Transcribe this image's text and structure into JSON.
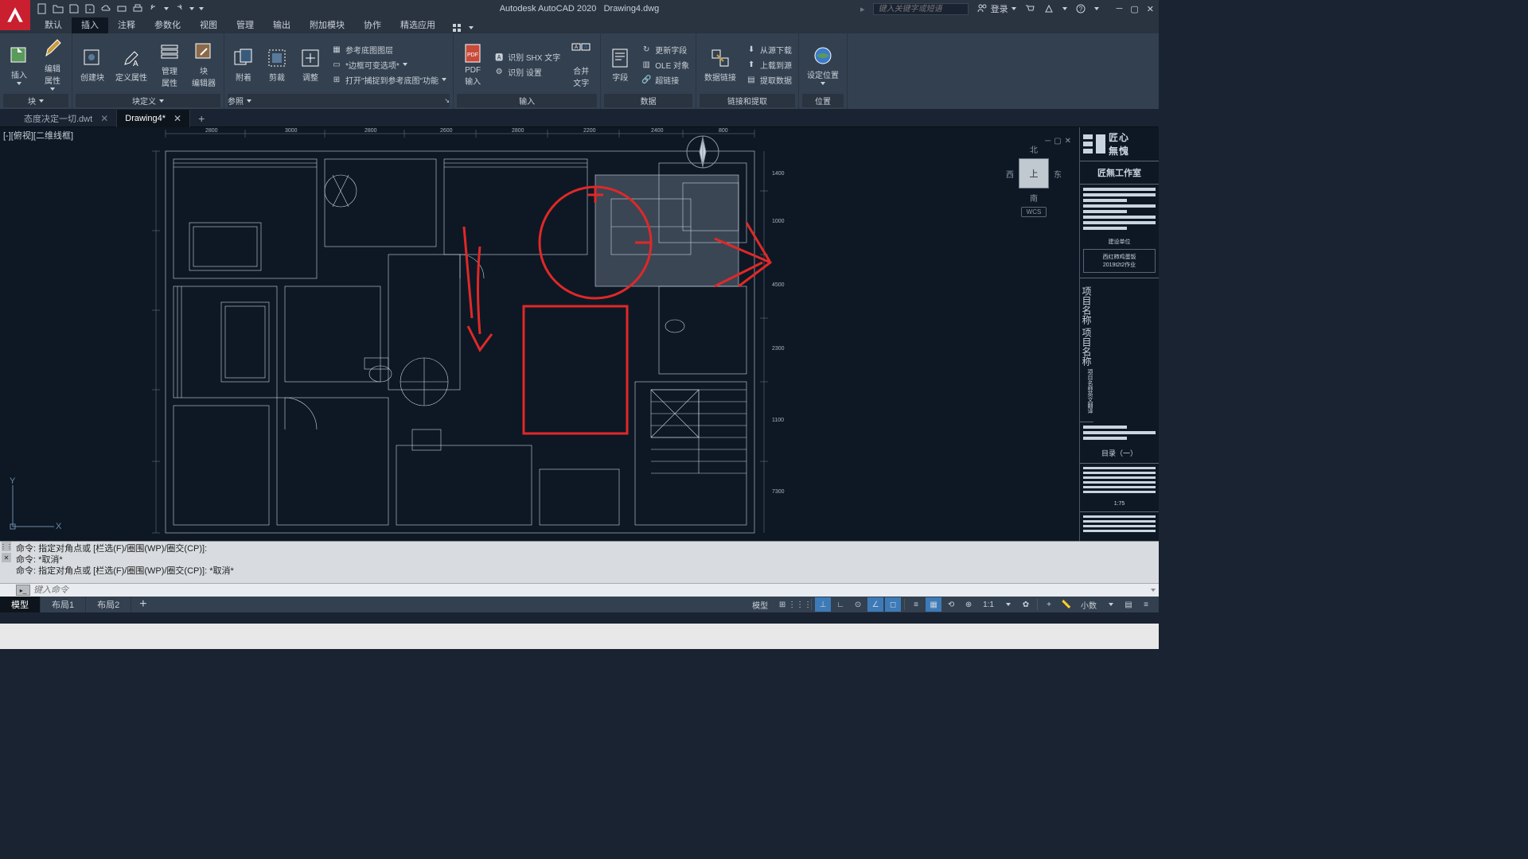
{
  "app": {
    "title": "Autodesk AutoCAD 2020",
    "file": "Drawing4.dwg",
    "search_placeholder": "键入关键字或短语",
    "login": "登录"
  },
  "menu": {
    "tabs": [
      "默认",
      "插入",
      "注释",
      "参数化",
      "视图",
      "管理",
      "输出",
      "附加模块",
      "协作",
      "精选应用"
    ],
    "active_index": 1
  },
  "ribbon": {
    "groups": [
      {
        "label": "块",
        "large": [
          {
            "label": "插入",
            "icon": "insert-block"
          },
          {
            "label": "编辑\n属性",
            "icon": "edit-attr"
          }
        ]
      },
      {
        "label": "块定义",
        "large": [
          {
            "label": "创建块",
            "icon": "create-block"
          },
          {
            "label": "定义属性",
            "icon": "define-attr"
          },
          {
            "label": "管理\n属性",
            "icon": "manage-attr"
          },
          {
            "label": "块\n编辑器",
            "icon": "block-editor"
          }
        ]
      },
      {
        "label": "参照",
        "large": [
          {
            "label": "附着",
            "icon": "attach"
          },
          {
            "label": "剪裁",
            "icon": "clip"
          },
          {
            "label": "调整",
            "icon": "adjust"
          }
        ],
        "small": [
          "参考底图图层",
          "*边框可变选项*",
          "打开\"捕捉到参考底图\"功能"
        ]
      },
      {
        "label": "输入",
        "large": [
          {
            "label": "PDF\n输入",
            "icon": "pdf"
          }
        ],
        "small": [
          "识别 SHX 文字",
          "识别 设置"
        ],
        "large2": [
          {
            "label": "合并\n文字",
            "icon": "merge-text"
          }
        ]
      },
      {
        "label": "数据",
        "large": [
          {
            "label": "字段",
            "icon": "field"
          }
        ],
        "small": [
          "更新字段",
          "OLE 对象",
          "超链接"
        ]
      },
      {
        "label": "链接和提取",
        "large": [
          {
            "label": "数据链接",
            "icon": "data-link"
          }
        ],
        "small": [
          "从源下载",
          "上载到源",
          "提取数据"
        ]
      },
      {
        "label": "位置",
        "large": [
          {
            "label": "设定位置",
            "icon": "location"
          }
        ]
      }
    ]
  },
  "file_tabs": [
    {
      "name": "态度决定一切.dwt",
      "active": false
    },
    {
      "name": "Drawing4*",
      "active": true
    }
  ],
  "viewport": {
    "label": "[-][俯视][二维线框]",
    "nav": {
      "n": "北",
      "s": "南",
      "e": "东",
      "w": "西",
      "top": "上",
      "wcs": "WCS"
    }
  },
  "title_block": {
    "logo1": "匠心",
    "logo2": "無愧",
    "studio": "匠無工作室",
    "unit_label": "建设单位",
    "unit1": "西红柿鸡蛋饭",
    "unit2": "2019t2t2作业",
    "project1": "项目名称",
    "project2": "项目名称",
    "project3": "项目名称英文翻译",
    "toc": "目录（一）",
    "scale": "1:75"
  },
  "command": {
    "lines": [
      "命令: 指定对角点或 [栏选(F)/圈围(WP)/圈交(CP)]:",
      "命令: *取消*",
      "命令: 指定对角点或 [栏选(F)/圈围(WP)/圈交(CP)]: *取消*"
    ],
    "prompt_placeholder": "键入命令"
  },
  "layout_tabs": {
    "tabs": [
      "模型",
      "布局1",
      "布局2"
    ],
    "active_index": 0
  },
  "status": {
    "model": "模型",
    "ratio": "1:1",
    "decimal": "小数"
  },
  "ucs": {
    "x": "X",
    "y": "Y"
  }
}
